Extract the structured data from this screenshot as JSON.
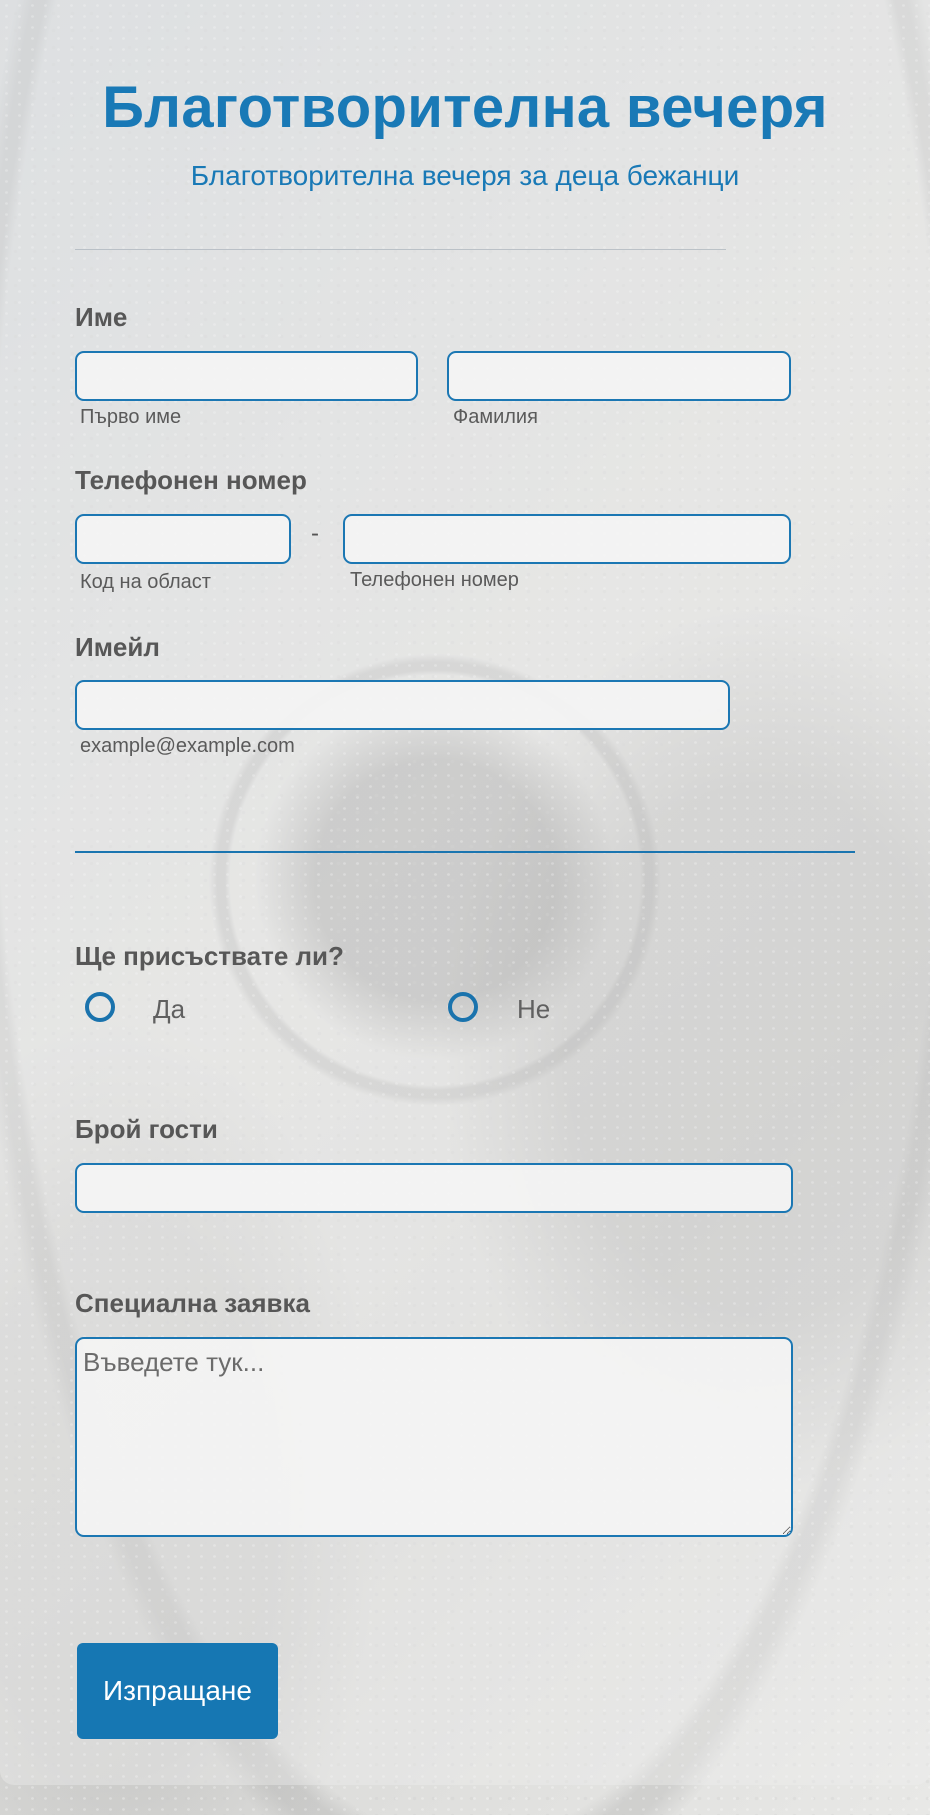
{
  "header": {
    "title": "Благотворителна вечеря",
    "subtitle": "Благотворителна вечеря за деца бежанци"
  },
  "name": {
    "label": "Име",
    "first_sublabel": "Първо име",
    "last_sublabel": "Фамилия",
    "first_value": "",
    "last_value": ""
  },
  "phone": {
    "label": "Телефонен номер",
    "separator": "-",
    "area_sublabel": "Код на област",
    "number_sublabel": "Телефонен номер",
    "area_value": "",
    "number_value": ""
  },
  "email": {
    "label": "Имейл",
    "sublabel": "example@example.com",
    "value": ""
  },
  "attend": {
    "label": "Ще присъствате ли?",
    "options": [
      {
        "label": "Да",
        "selected": false
      },
      {
        "label": "Не",
        "selected": false
      }
    ]
  },
  "guests": {
    "label": "Брой гости",
    "value": ""
  },
  "request": {
    "label": "Специална заявка",
    "placeholder": "Въведете тук...",
    "value": ""
  },
  "submit_label": "Изпращане",
  "colors": {
    "accent": "#1979b6",
    "label_text": "#575757",
    "button_bg": "#1677b3"
  }
}
